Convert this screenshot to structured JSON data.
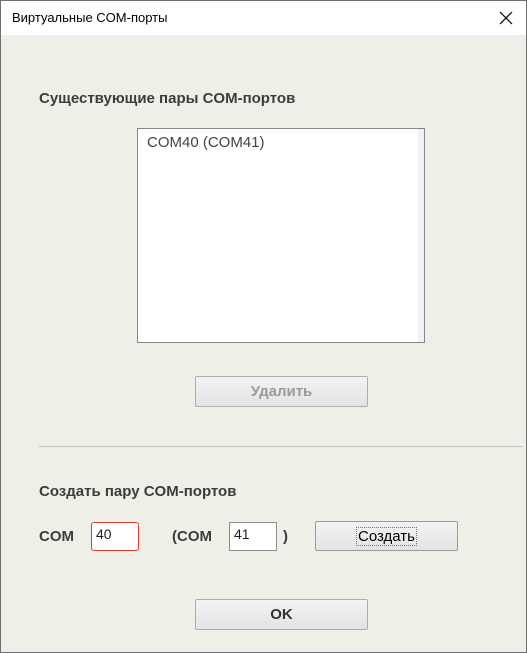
{
  "window": {
    "title": "Виртуальные COM-порты",
    "close_symbol": "×"
  },
  "existing": {
    "heading": "Существующие пары COM-портов",
    "items": [
      "COM40 (COM41)"
    ],
    "delete_label": "Удалить"
  },
  "create": {
    "heading": "Создать пару COM-портов",
    "com_label": "COM",
    "paired_label": "(COM",
    "close_paren": ")",
    "first_port": "40",
    "second_port": "41",
    "create_label": "Создать"
  },
  "ok_label": "OK"
}
